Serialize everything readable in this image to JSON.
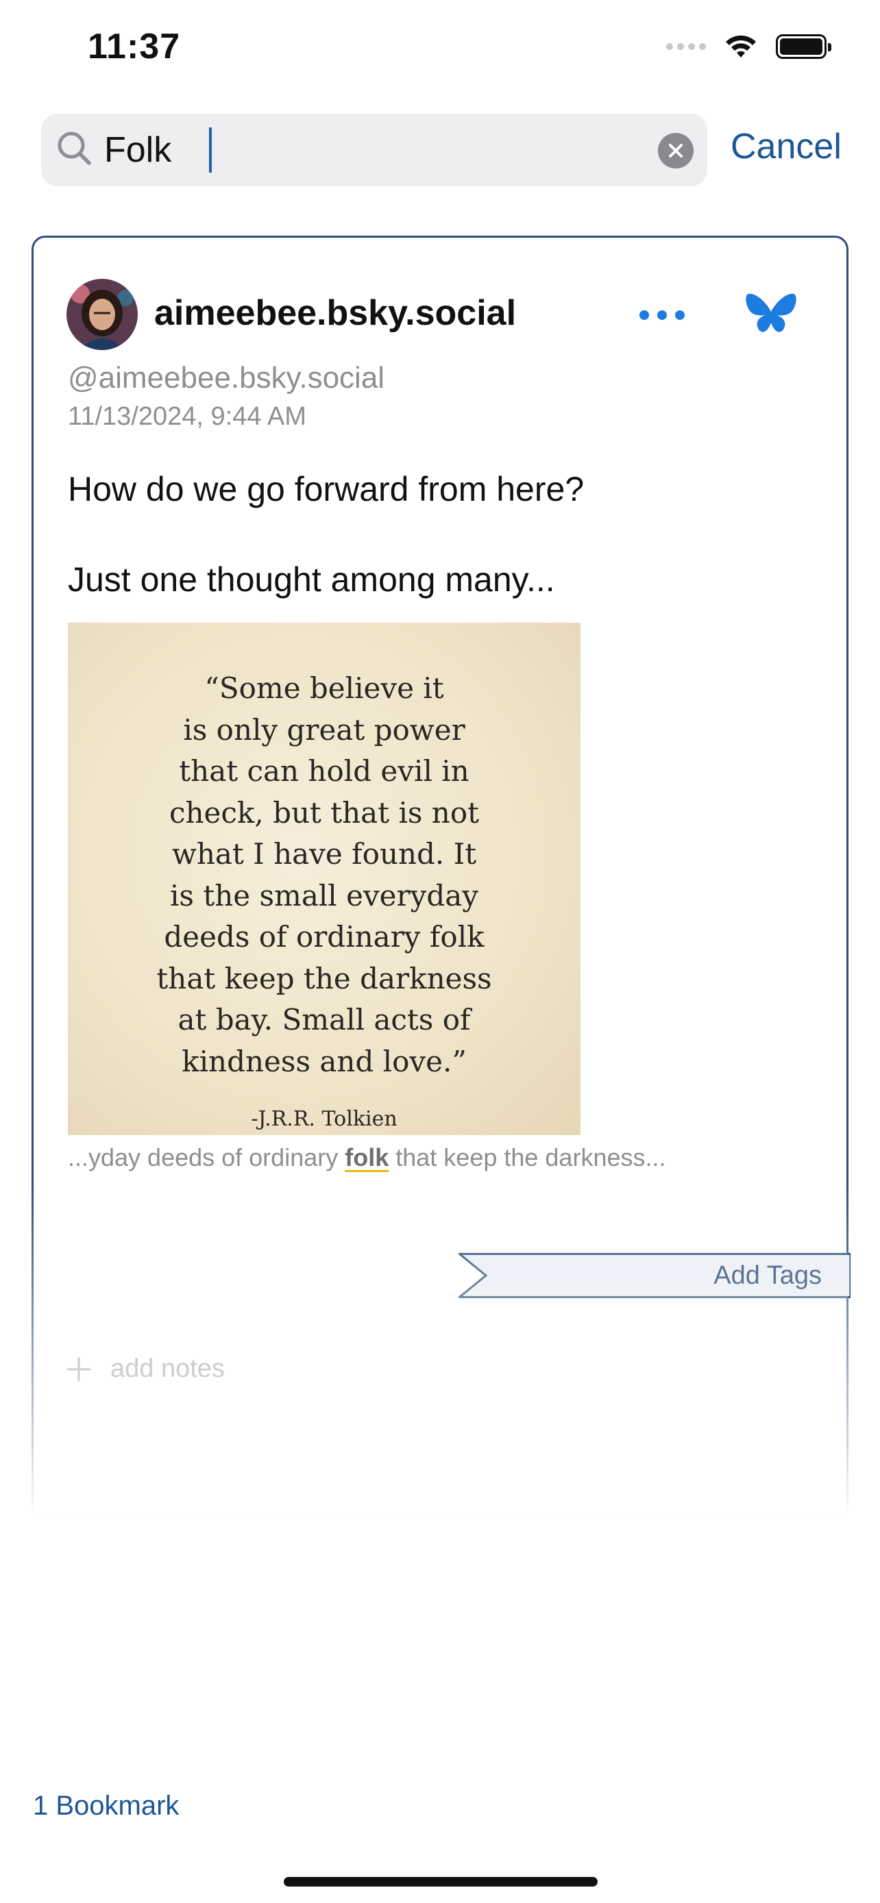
{
  "status_bar": {
    "time": "11:37"
  },
  "search": {
    "value": "Folk",
    "cancel_label": "Cancel"
  },
  "post": {
    "display_name": "aimeebee.bsky.social",
    "handle": "@aimeebee.bsky.social",
    "timestamp": "11/13/2024, 9:44 AM",
    "text_line1": "How do we go forward from here?",
    "text_line2": "Just one thought among many...",
    "image": {
      "quote_lines": [
        "“Some believe it",
        "is only great power",
        "that can hold evil in",
        "check, but that is not",
        "what I have found. It",
        "is the small everyday",
        "deeds of ordinary folk",
        "that keep the darkness",
        "at bay. Small acts of",
        "kindness and love.”"
      ],
      "author": "-J.R.R. Tolkien"
    },
    "snippet": {
      "before": "...yday deeds of ordinary ",
      "match": "folk",
      "after": " that keep the darkness..."
    },
    "add_tags_label": "Add Tags",
    "add_notes_label": "add notes"
  },
  "footer": {
    "bookmark_count": "1 Bookmark"
  },
  "colors": {
    "accent": "#1b5796",
    "bluesky": "#1d7ce0",
    "highlight_underline": "#f0b400"
  }
}
